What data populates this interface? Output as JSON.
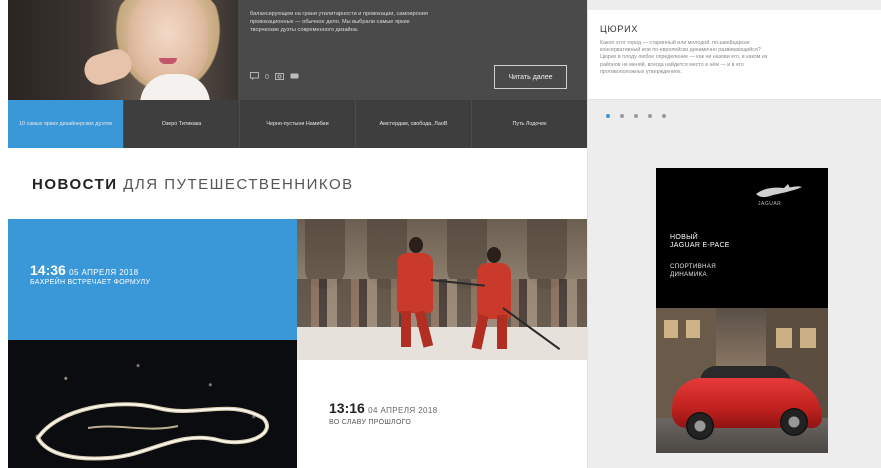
{
  "hero": {
    "text_lines": [
      "балансирующем на грани утилитарности и провокации, самоирония",
      "провокационных — обычное дело. Мы выбрали самые яркие",
      "творческие дуэты современного дизайна."
    ],
    "icon_count": "0",
    "read_more_label": "Читать далее"
  },
  "tabs": [
    {
      "label": "10 самых ярких дизайнерских дуэтов",
      "active": true
    },
    {
      "label": "Озеро Титикака",
      "active": false
    },
    {
      "label": "Черно-пустыни Намибии",
      "active": false
    },
    {
      "label": "Амстердам, свобода, ЛаоВ",
      "active": false
    },
    {
      "label": "Путь Лодочек",
      "active": false
    }
  ],
  "news": {
    "title_bold": "НОВОСТИ",
    "title_light": "ДЛЯ ПУТЕШЕСТВЕННИКОВ",
    "items": [
      {
        "time": "14:36",
        "date": "05 АПРЕЛЯ 2018",
        "headline": "БАХРЕЙН ВСТРЕЧАЕТ ФОРМУЛУ"
      },
      {
        "time": "13:16",
        "date": "04 АПРЕЛЯ 2018",
        "headline": "ВО СЛАВУ ПРОШЛОГО"
      }
    ]
  },
  "sidebar": {
    "title": "ЦЮРИХ",
    "text_lines": [
      "Какое этот город — старинный или молодой, по-швейцарски",
      "консервативный или по-европейски динамично развивающийся?",
      "Цюрих в плоду любое определение — как ни назови его, в каком из",
      "районов не меняй, всегда найдется место в нём — и в его",
      "противоположных утверждениях."
    ],
    "slider_dots": 5,
    "active_dot": 0
  },
  "ad": {
    "brand": "JAGUAR",
    "headline_1": "НОВЫЙ",
    "headline_2": "JAGUAR E-PACE",
    "sub_1": "СПОРТИВНАЯ",
    "sub_2": "ДИНАМИКА"
  },
  "colors": {
    "accent_blue": "#3a98d8",
    "dark_bar": "#3e3e3e",
    "hero_bg": "#4a4a4a",
    "sidebar_bg": "#ededed"
  },
  "icons": [
    "comment-icon",
    "camera-icon",
    "share-icon"
  ]
}
